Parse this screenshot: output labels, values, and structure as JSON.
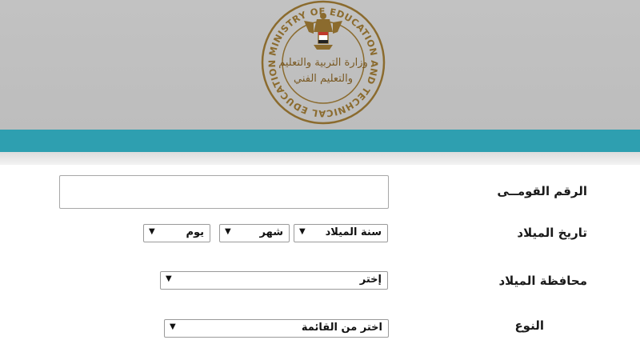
{
  "logo": {
    "ring_text": "MINISTRY OF EDUCATION AND TECHNICAL EDUCATION",
    "arabic_line1": "وزارة التربية والتعليم",
    "arabic_line2": "والتعليم الفني",
    "color": "#8b6b2e"
  },
  "colors": {
    "header_bg": "#bfbfbf",
    "accent_bar": "#2e9fb0"
  },
  "form": {
    "national_id": {
      "label": "الرقم القومــى",
      "value": ""
    },
    "birth_date": {
      "label": "تاريخ الميلاد",
      "year": "سنة الميلاد",
      "month": "شهر",
      "day": "يوم"
    },
    "birth_governorate": {
      "label": "محافظة الميلاد",
      "selected": "إختر"
    },
    "gender": {
      "label": "النوع",
      "selected": "اختر من القائمة"
    }
  },
  "icons": {
    "dropdown": "triangle-down-icon"
  }
}
